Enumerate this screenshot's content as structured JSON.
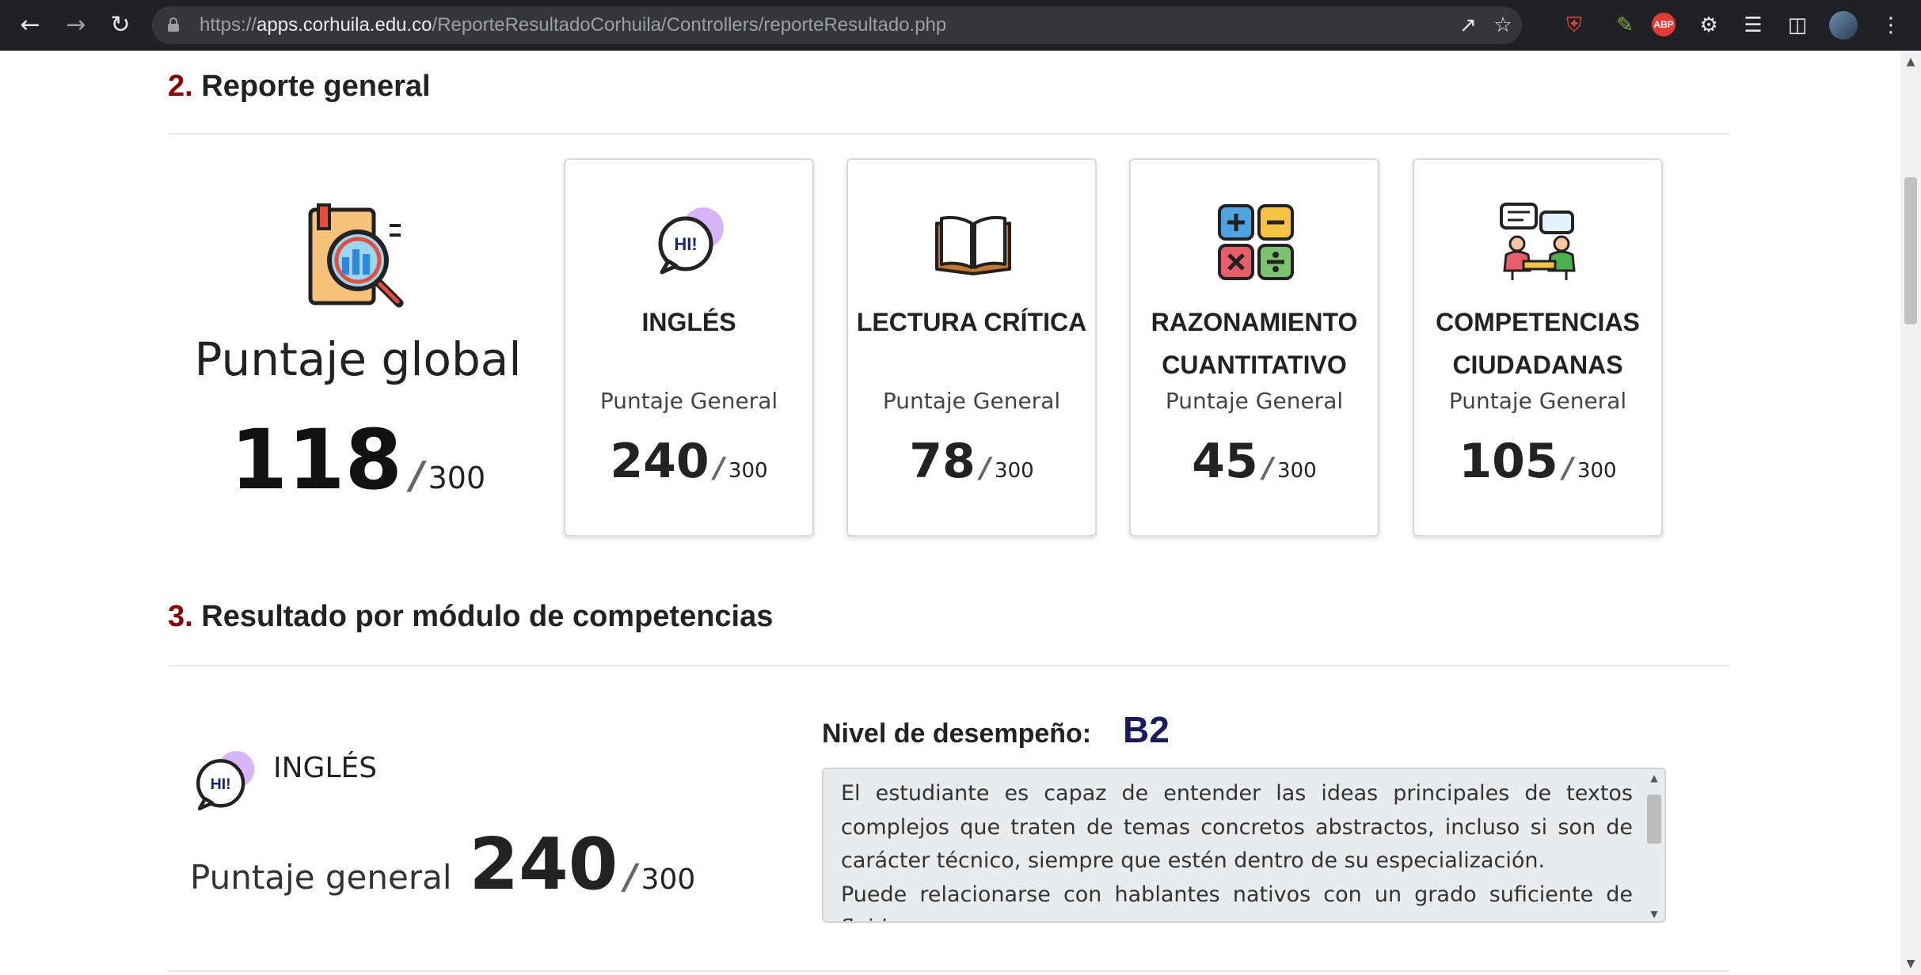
{
  "browser": {
    "url_scheme": "https://",
    "url_host": "apps.corhuila.edu.co",
    "url_path": "/ReporteResultadoCorhuila/Controllers/reporteResultado.php",
    "extensions": [
      "brave-shield-icon",
      "pen-extension-icon",
      "adblock-plus-icon",
      "puzzle-extensions-icon",
      "reading-list-icon",
      "side-panel-icon",
      "profile-avatar"
    ],
    "abp_label": "ABP"
  },
  "section2": {
    "number": "2.",
    "title": "Reporte general"
  },
  "global": {
    "label": "Puntaje global",
    "score": "118",
    "slash": "/",
    "max": "300"
  },
  "cards": [
    {
      "title": "INGLÉS",
      "subtitle": "Puntaje General",
      "score": "240",
      "slash": "/",
      "max": "300",
      "icon": "hi-speech-bubble-icon"
    },
    {
      "title": "LECTURA CRÍTICA",
      "subtitle": "Puntaje General",
      "score": "78",
      "slash": "/",
      "max": "300",
      "icon": "open-book-icon"
    },
    {
      "title_line1": "RAZONAMIENTO",
      "title_line2": "CUANTITATIVO",
      "subtitle": "Puntaje General",
      "score": "45",
      "slash": "/",
      "max": "300",
      "icon": "calculator-symbols-icon"
    },
    {
      "title_line1": "COMPETENCIAS",
      "title_line2": "CIUDADANAS",
      "subtitle": "Puntaje General",
      "score": "105",
      "slash": "/",
      "max": "300",
      "icon": "people-meeting-icon"
    }
  ],
  "section3": {
    "number": "3.",
    "title": "Resultado por módulo de competencias"
  },
  "module": {
    "name": "INGLÉS",
    "score_label": "Puntaje general",
    "score": "240",
    "slash": "/",
    "max": "300",
    "icon_text": "HI!",
    "nivel_label": "Nivel de desempeño:",
    "nivel_value": "B2",
    "description_p1": "El estudiante es capaz de entender las ideas principales de textos complejos que traten de temas concretos abstractos, incluso si son de carácter técnico, siempre que estén dentro de su especialización.",
    "description_p2": "Puede relacionarse con hablantes nativos con un grado suficiente de fluidez y"
  },
  "icons": {
    "hi_text": "HI!"
  },
  "colors": {
    "section_number": "#8b0000",
    "level_value": "#1a1a5e",
    "hi_accent": "#d8b4f8"
  }
}
